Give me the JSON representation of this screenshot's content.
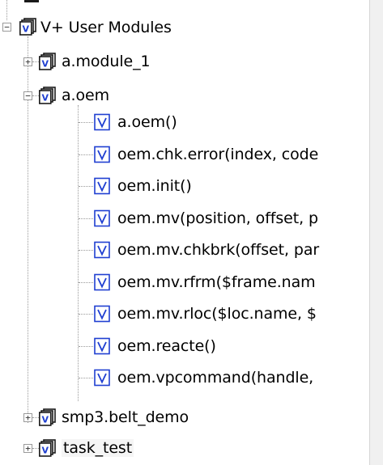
{
  "tree": {
    "root": {
      "label": "V+ User Modules",
      "toggle": "−",
      "icon": "module-stack-icon"
    },
    "modules": [
      {
        "label": "a.module_1",
        "toggle": "+",
        "icon": "module-stack-icon"
      },
      {
        "label": "a.oem",
        "toggle": "−",
        "icon": "module-stack-icon",
        "children": [
          {
            "label": "a.oem()",
            "icon": "v-program-icon"
          },
          {
            "label": "oem.chk.error(index, code",
            "icon": "v-program-icon"
          },
          {
            "label": "oem.init()",
            "icon": "v-program-icon"
          },
          {
            "label": "oem.mv(position, offset, p",
            "icon": "v-program-icon"
          },
          {
            "label": "oem.mv.chkbrk(offset, par",
            "icon": "v-program-icon"
          },
          {
            "label": "oem.mv.rfrm($frame.nam",
            "icon": "v-program-icon"
          },
          {
            "label": "oem.mv.rloc($loc.name, $",
            "icon": "v-program-icon"
          },
          {
            "label": "oem.reacte()",
            "icon": "v-program-icon"
          },
          {
            "label": "oem.vpcommand(handle,",
            "icon": "v-program-icon"
          }
        ]
      },
      {
        "label": "smp3.belt_demo",
        "toggle": "+",
        "icon": "module-stack-icon"
      },
      {
        "label": "task_test",
        "toggle": "+",
        "icon": "module-stack-icon",
        "selected": true
      }
    ]
  },
  "colors": {
    "icon_blue": "#1f3fd1",
    "icon_dark": "#1a1a1a",
    "tree_line": "#9a9a9a",
    "selection_bg": "#f5f5f5"
  }
}
